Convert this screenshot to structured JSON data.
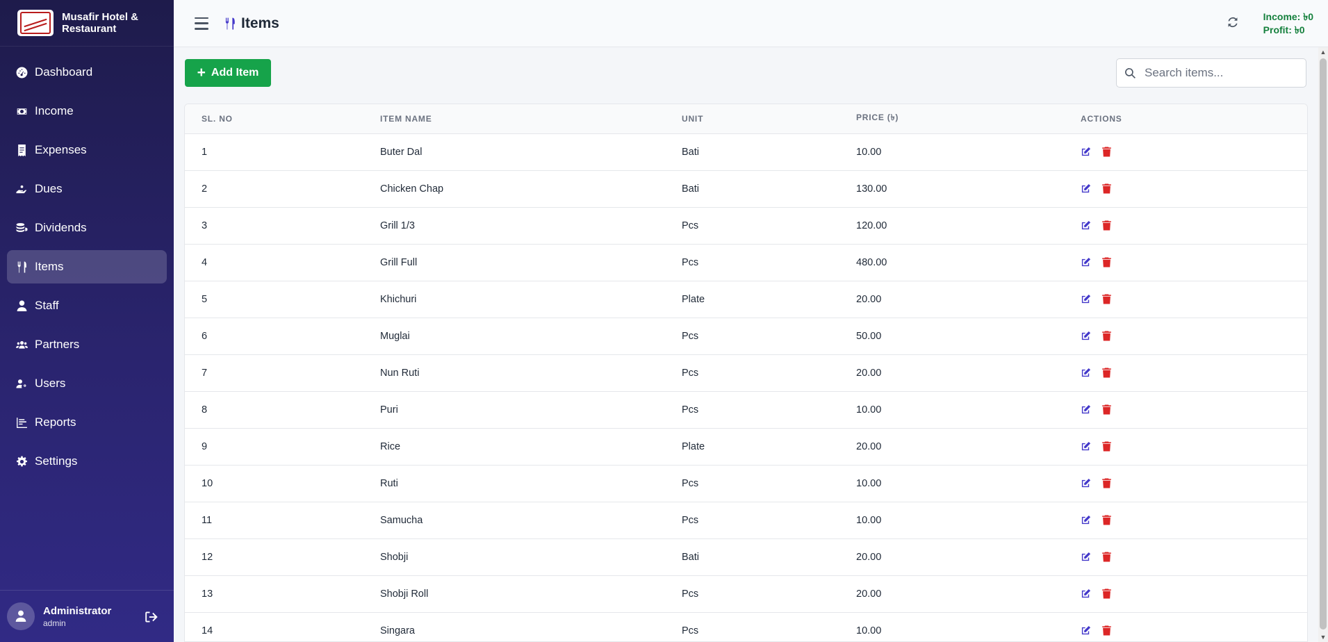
{
  "brand": {
    "name": "Musafir Hotel & Restaurant"
  },
  "sidebar": {
    "items": [
      {
        "label": "Dashboard",
        "icon": "gauge-icon"
      },
      {
        "label": "Income",
        "icon": "money-icon"
      },
      {
        "label": "Expenses",
        "icon": "receipt-icon"
      },
      {
        "label": "Dues",
        "icon": "hand-holding-icon"
      },
      {
        "label": "Dividends",
        "icon": "coins-icon"
      },
      {
        "label": "Items",
        "icon": "utensils-icon",
        "active": true
      },
      {
        "label": "Staff",
        "icon": "user-icon"
      },
      {
        "label": "Partners",
        "icon": "users-icon"
      },
      {
        "label": "Users",
        "icon": "user-cog-icon"
      },
      {
        "label": "Reports",
        "icon": "chart-bar-icon"
      },
      {
        "label": "Settings",
        "icon": "gear-icon"
      }
    ]
  },
  "user": {
    "name": "Administrator",
    "role": "admin"
  },
  "header": {
    "title": "Items",
    "income": "Income: ৳0",
    "profit": "Profit: ৳0"
  },
  "toolbar": {
    "add_label": "Add Item",
    "search_placeholder": "Search items..."
  },
  "table": {
    "columns": [
      "SL. NO",
      "ITEM NAME",
      "UNIT",
      "PRICE (৳)",
      "ACTIONS"
    ],
    "rows": [
      {
        "sl": "1",
        "name": "Buter Dal",
        "unit": "Bati",
        "price": "10.00"
      },
      {
        "sl": "2",
        "name": "Chicken Chap",
        "unit": "Bati",
        "price": "130.00"
      },
      {
        "sl": "3",
        "name": "Grill 1/3",
        "unit": "Pcs",
        "price": "120.00"
      },
      {
        "sl": "4",
        "name": "Grill Full",
        "unit": "Pcs",
        "price": "480.00"
      },
      {
        "sl": "5",
        "name": "Khichuri",
        "unit": "Plate",
        "price": "20.00"
      },
      {
        "sl": "6",
        "name": "Muglai",
        "unit": "Pcs",
        "price": "50.00"
      },
      {
        "sl": "7",
        "name": "Nun Ruti",
        "unit": "Pcs",
        "price": "20.00"
      },
      {
        "sl": "8",
        "name": "Puri",
        "unit": "Pcs",
        "price": "10.00"
      },
      {
        "sl": "9",
        "name": "Rice",
        "unit": "Plate",
        "price": "20.00"
      },
      {
        "sl": "10",
        "name": "Ruti",
        "unit": "Pcs",
        "price": "10.00"
      },
      {
        "sl": "11",
        "name": "Samucha",
        "unit": "Pcs",
        "price": "10.00"
      },
      {
        "sl": "12",
        "name": "Shobji",
        "unit": "Bati",
        "price": "20.00"
      },
      {
        "sl": "13",
        "name": "Shobji Roll",
        "unit": "Pcs",
        "price": "20.00"
      },
      {
        "sl": "14",
        "name": "Singara",
        "unit": "Pcs",
        "price": "10.00"
      }
    ]
  },
  "colors": {
    "sidebar": "#1e1b4b",
    "accent": "#4338ca",
    "add_button": "#16a34a",
    "danger": "#dc2626",
    "profit_text": "#15803d"
  }
}
